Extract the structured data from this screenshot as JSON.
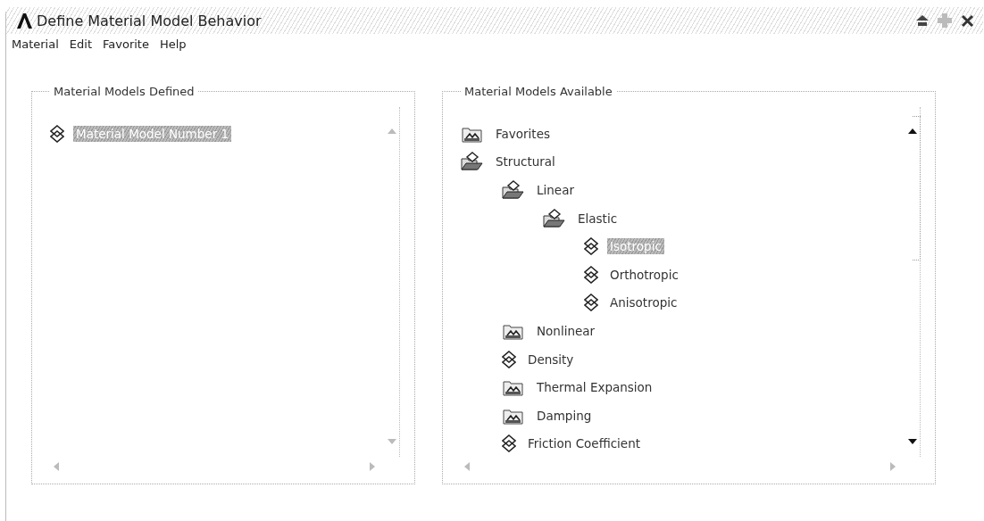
{
  "window": {
    "title": "Define Material Model Behavior"
  },
  "menu": [
    {
      "label": "Material"
    },
    {
      "label": "Edit"
    },
    {
      "label": "Favorite"
    },
    {
      "label": "Help"
    }
  ],
  "models_defined": {
    "title": "Material Models Defined",
    "items": [
      {
        "label": "Material Model Number 1",
        "selected": true
      }
    ]
  },
  "models_available": {
    "title": "Material Models Available",
    "tree": [
      {
        "label": "Favorites",
        "kind": "folder",
        "expanded": false,
        "selected": false
      },
      {
        "label": "Structural",
        "kind": "folder",
        "expanded": true,
        "selected": false,
        "children": [
          {
            "label": "Linear",
            "kind": "folder",
            "expanded": true,
            "selected": false,
            "children": [
              {
                "label": "Elastic",
                "kind": "folder",
                "expanded": true,
                "selected": false,
                "children": [
                  {
                    "label": "Isotropic",
                    "kind": "model",
                    "selected": true
                  },
                  {
                    "label": "Orthotropic",
                    "kind": "model",
                    "selected": false
                  },
                  {
                    "label": "Anisotropic",
                    "kind": "model",
                    "selected": false
                  }
                ]
              }
            ]
          },
          {
            "label": "Nonlinear",
            "kind": "folder",
            "expanded": false,
            "selected": false
          },
          {
            "label": "Density",
            "kind": "model",
            "selected": false
          },
          {
            "label": "Thermal Expansion",
            "kind": "folder",
            "expanded": false,
            "selected": false
          },
          {
            "label": "Damping",
            "kind": "folder",
            "expanded": false,
            "selected": false
          },
          {
            "label": "Friction Coefficient",
            "kind": "model",
            "selected": false
          }
        ]
      }
    ]
  }
}
